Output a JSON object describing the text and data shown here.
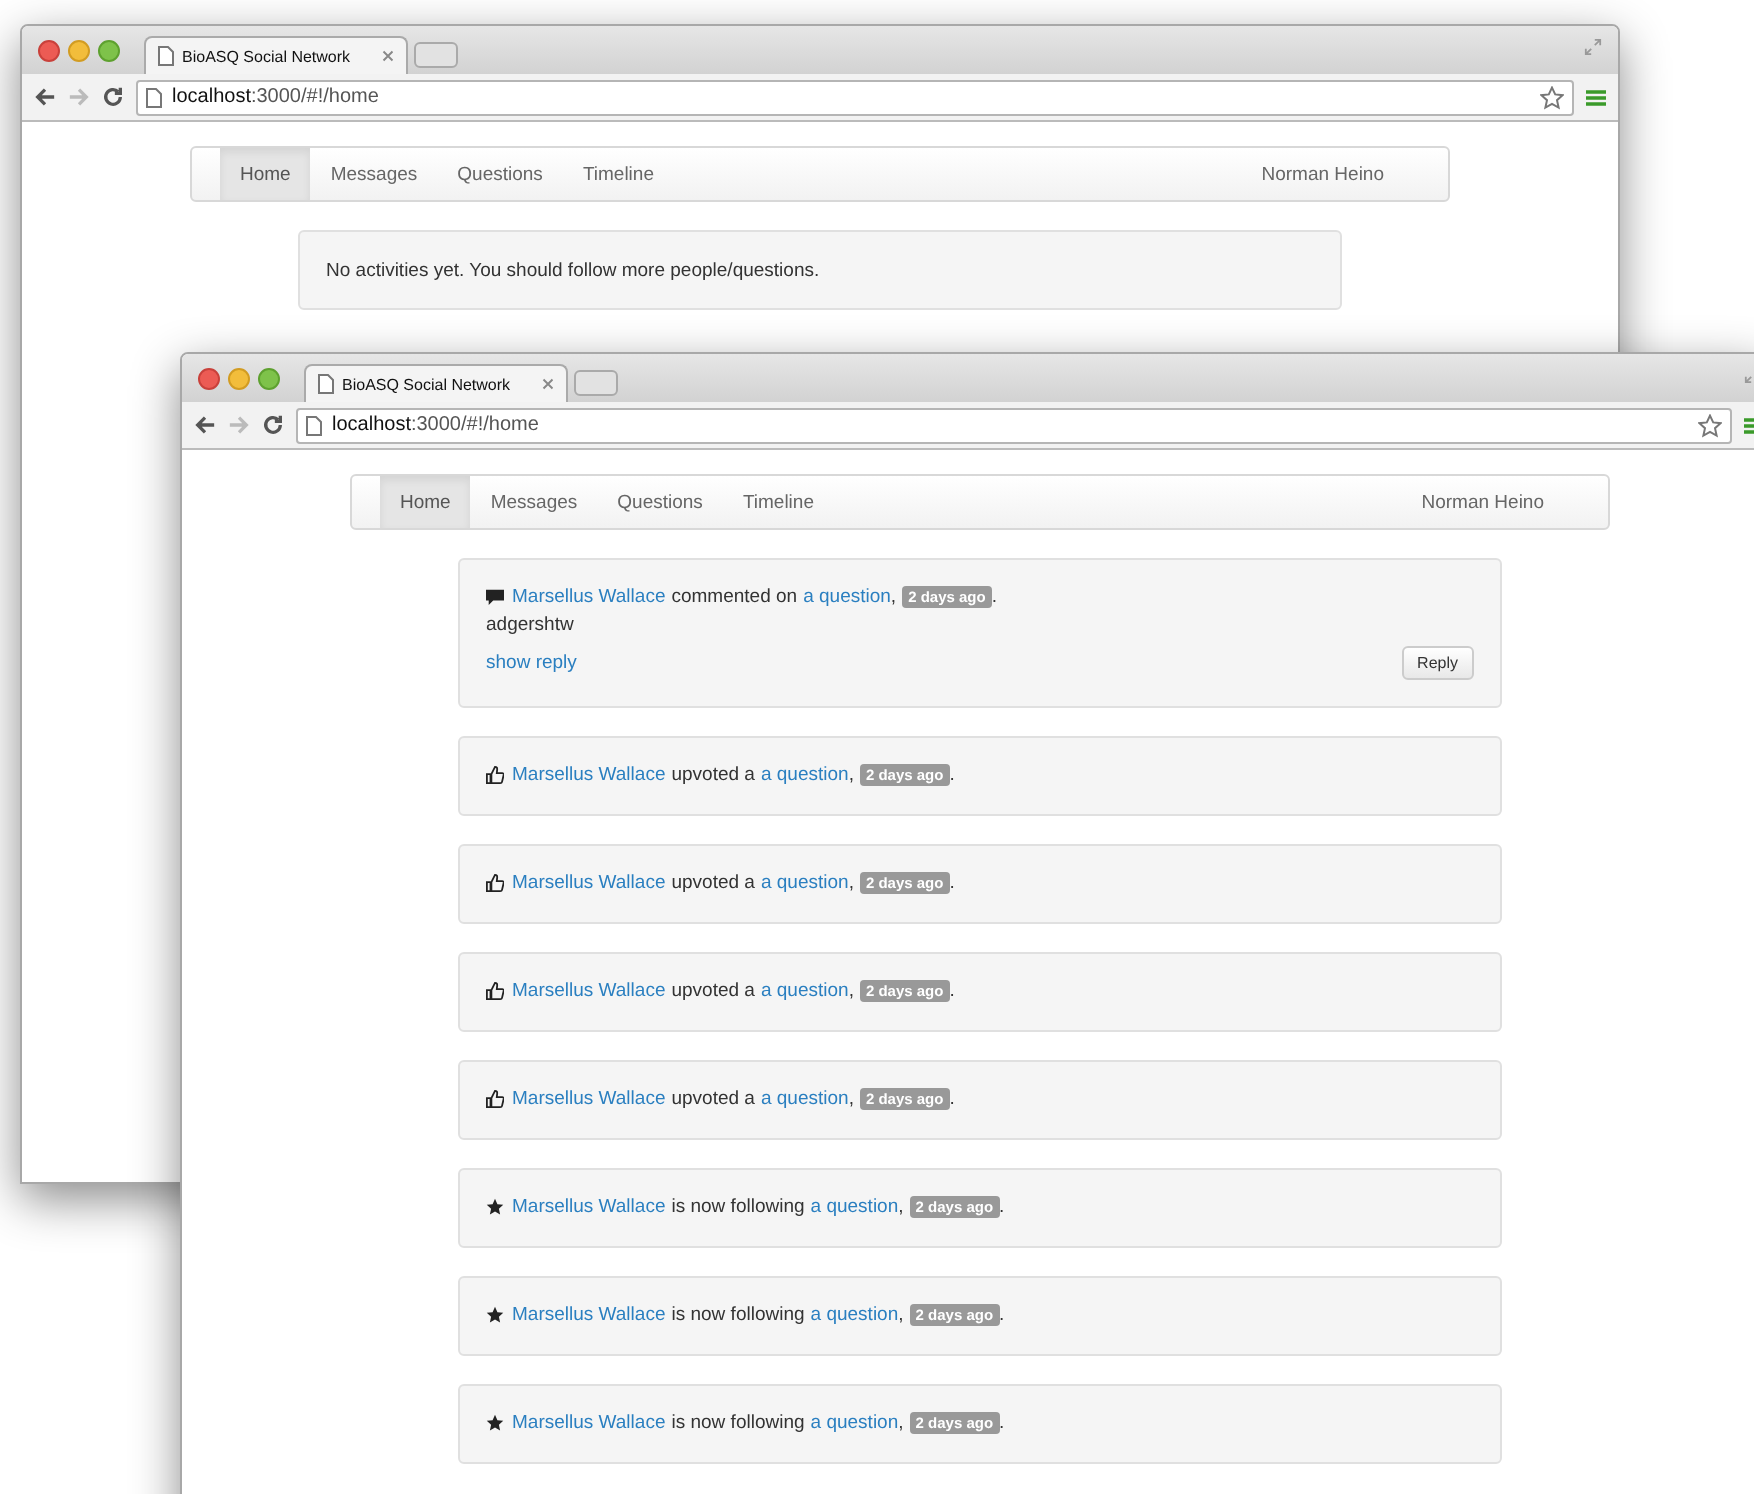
{
  "windows": [
    {
      "tab_title": "BioASQ Social Network",
      "url_host": "localhost",
      "url_path": ":3000/#!/home",
      "nav": [
        {
          "label": "Home",
          "selected": true
        },
        {
          "label": "Messages",
          "selected": false
        },
        {
          "label": "Questions",
          "selected": false
        },
        {
          "label": "Timeline",
          "selected": false
        }
      ],
      "user": "Norman Heino",
      "empty_message": "No activities yet. You should follow more people/questions."
    },
    {
      "tab_title": "BioASQ Social Network",
      "url_host": "localhost",
      "url_path": ":3000/#!/home",
      "nav": [
        {
          "label": "Home",
          "selected": true
        },
        {
          "label": "Messages",
          "selected": false
        },
        {
          "label": "Questions",
          "selected": false
        },
        {
          "label": "Timeline",
          "selected": false
        }
      ],
      "user": "Norman Heino",
      "activities": [
        {
          "kind": "comment",
          "actor": "Marsellus Wallace",
          "verb": "commented on",
          "target": "a question",
          "separator": ",",
          "time": "2 days ago",
          "end": ".",
          "comment": "adgershtw",
          "show_reply": "show reply",
          "reply_button": "Reply"
        },
        {
          "kind": "upvote",
          "actor": "Marsellus Wallace",
          "verb": "upvoted a",
          "target": "a question",
          "separator": ",",
          "time": "2 days ago",
          "end": "."
        },
        {
          "kind": "upvote",
          "actor": "Marsellus Wallace",
          "verb": "upvoted a",
          "target": "a question",
          "separator": ",",
          "time": "2 days ago",
          "end": "."
        },
        {
          "kind": "upvote",
          "actor": "Marsellus Wallace",
          "verb": "upvoted a",
          "target": "a question",
          "separator": ",",
          "time": "2 days ago",
          "end": "."
        },
        {
          "kind": "upvote",
          "actor": "Marsellus Wallace",
          "verb": "upvoted a",
          "target": "a question",
          "separator": ",",
          "time": "2 days ago",
          "end": "."
        },
        {
          "kind": "follow",
          "actor": "Marsellus Wallace",
          "verb": "is now following",
          "target": "a question",
          "separator": ",",
          "time": "2 days ago",
          "end": "."
        },
        {
          "kind": "follow",
          "actor": "Marsellus Wallace",
          "verb": "is now following",
          "target": "a question",
          "separator": ",",
          "time": "2 days ago",
          "end": "."
        },
        {
          "kind": "follow",
          "actor": "Marsellus Wallace",
          "verb": "is now following",
          "target": "a question",
          "separator": ",",
          "time": "2 days ago",
          "end": "."
        }
      ]
    }
  ]
}
